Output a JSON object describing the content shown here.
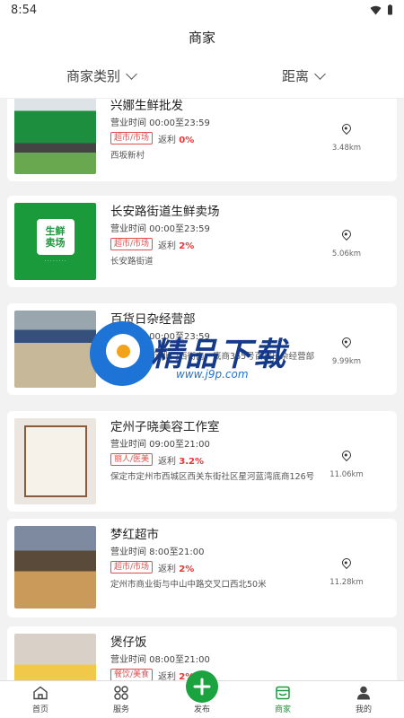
{
  "status": {
    "time": "8:54"
  },
  "header": {
    "title": "商家"
  },
  "filters": {
    "category": "商家类别",
    "distance": "距离"
  },
  "merchants": [
    {
      "name": "兴娜生鲜批发",
      "hours": "营业时间 00:00至23:59",
      "tag": "超市/市场",
      "rebate_label": "返利",
      "rebate": "0%",
      "address": "西坂新村",
      "distance": "3.48km",
      "thumb_icon": "supermarket-storefront-image"
    },
    {
      "name": "长安路街道生鲜卖场",
      "hours": "营业时间 00:00至23:59",
      "tag": "超市/市场",
      "rebate_label": "返利",
      "rebate": "2%",
      "address": "长安路街道",
      "distance": "5.06km",
      "thumb_icon": "fresh-market-logo-image",
      "logo_text_1": "生鲜",
      "logo_text_2": "卖场"
    },
    {
      "name": "百货日杂经营部",
      "hours": "营业时间 00:00至23:59",
      "tag": "",
      "rebate_label": "",
      "rebate": "",
      "address": "定州市西城区北门西街南一底商365号百货日杂经营部",
      "distance": "9.99km",
      "thumb_icon": "general-store-image"
    },
    {
      "name": "定州子晓美容工作室",
      "hours": "营业时间 09:00至21:00",
      "tag": "丽人/医美",
      "rebate_label": "返利",
      "rebate": "3.2%",
      "address": "保定市定州市西城区西关东街社区星河蓝湾底商126号",
      "distance": "11.06km",
      "thumb_icon": "beauty-studio-sign-image"
    },
    {
      "name": "梦红超市",
      "hours": "营业时间 8:00至21:00",
      "tag": "超市/市场",
      "rebate_label": "返利",
      "rebate": "2%",
      "address": "定州市商业街与中山中路交叉口西北50米",
      "distance": "11.28km",
      "thumb_icon": "supermarket-interior-image"
    },
    {
      "name": "煲仔饭",
      "hours": "营业时间 08:00至21:00",
      "tag": "餐饮/美食",
      "rebate_label": "返利",
      "rebate": "2%",
      "address": "",
      "distance": "",
      "thumb_icon": "restaurant-storefront-image"
    }
  ],
  "watermark": {
    "text": "精品下载",
    "url": "www.j9p.com"
  },
  "tabs": [
    {
      "label": "首页",
      "icon": "home-icon"
    },
    {
      "label": "服务",
      "icon": "grid-icon"
    },
    {
      "label": "发布",
      "icon": "plus-icon"
    },
    {
      "label": "商家",
      "icon": "store-icon"
    },
    {
      "label": "我的",
      "icon": "person-icon"
    }
  ],
  "colors": {
    "accent": "#1a9a3a",
    "tag_red": "#e05050",
    "rebate_red": "#e33333"
  }
}
